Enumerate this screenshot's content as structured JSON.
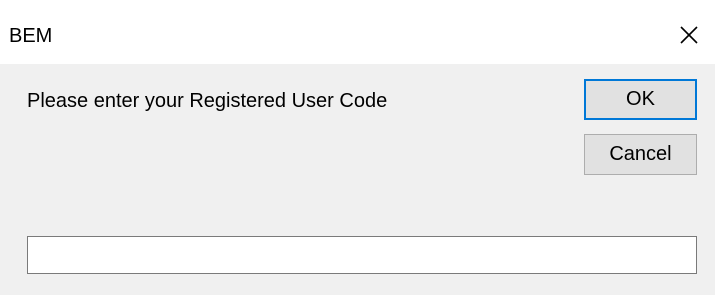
{
  "window": {
    "title": "BEM",
    "close_icon": "close-icon"
  },
  "dialog": {
    "prompt": "Please enter your Registered User Code",
    "ok_label": "OK",
    "cancel_label": "Cancel",
    "input_value": ""
  },
  "colors": {
    "focus_border": "#0078d7",
    "dialog_background": "#f0f0f0"
  }
}
